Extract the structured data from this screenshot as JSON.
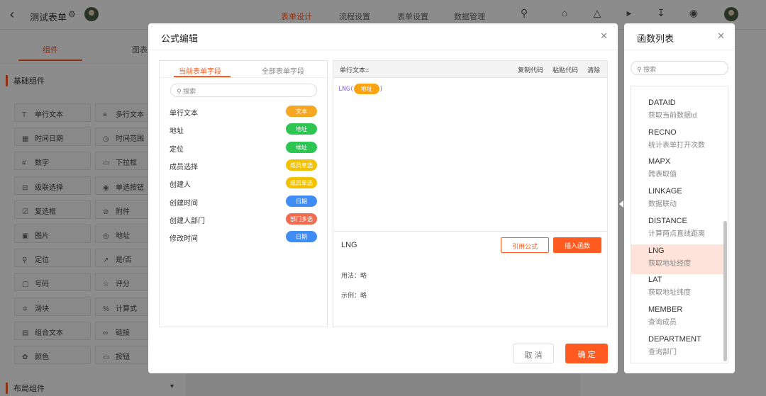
{
  "app": {
    "title": "测试表单"
  },
  "top_tabs": [
    "表单设计",
    "流程设置",
    "表单设置",
    "数据管理"
  ],
  "left_panel": {
    "tabs": [
      "组件",
      "图表"
    ],
    "section": "基础组件",
    "components": [
      "单行文本",
      "多行文本",
      "时间日期",
      "时间范围",
      "数字",
      "下拉框",
      "级联选择",
      "单选按钮",
      "复选框",
      "附件",
      "图片",
      "地址",
      "定位",
      "是/否",
      "号码",
      "评分",
      "滑块",
      "计算式",
      "组合文本",
      "链接",
      "颜色",
      "按钮"
    ],
    "bottom_section": "布局组件"
  },
  "modal": {
    "title": "公式编辑",
    "field_tabs": [
      "当前表单字段",
      "全部表单字段"
    ],
    "search_placeholder": "搜索",
    "fields": [
      {
        "label": "单行文本",
        "type": "文本",
        "color": "#f5a623"
      },
      {
        "label": "地址",
        "type": "地址",
        "color": "#2dc653"
      },
      {
        "label": "定位",
        "type": "地址",
        "color": "#2dc653"
      },
      {
        "label": "成员选择",
        "type": "成员单选",
        "color": "#f2c200"
      },
      {
        "label": "创建人",
        "type": "成员单选",
        "color": "#f2c200"
      },
      {
        "label": "创建时间",
        "type": "日期",
        "color": "#3f8cf4"
      },
      {
        "label": "创建人部门",
        "type": "部门多选",
        "color": "#f26b4f"
      },
      {
        "label": "修改时间",
        "type": "日期",
        "color": "#3f8cf4"
      }
    ],
    "editor": {
      "target": "单行文本=",
      "actions": [
        "复制代码",
        "粘贴代码",
        "清除"
      ],
      "formula_fn": "LNG(",
      "formula_arg": "地址",
      "formula_close": ")"
    },
    "function_detail": {
      "name": "LNG",
      "cite_button": "引用公式",
      "insert_button": "插入函数",
      "usage": "用法：略",
      "example": "示例：略"
    },
    "cancel": "取 消",
    "ok": "确 定"
  },
  "function_panel": {
    "title": "函数列表",
    "search_placeholder": "搜索",
    "functions": [
      {
        "name": "DATAID",
        "desc": "获取当前数据Id"
      },
      {
        "name": "RECNO",
        "desc": "统计表单打开次数"
      },
      {
        "name": "MAPX",
        "desc": "跨表取值"
      },
      {
        "name": "LINKAGE",
        "desc": "数据联动"
      },
      {
        "name": "DISTANCE",
        "desc": "计算两点直线距离"
      },
      {
        "name": "LNG",
        "desc": "获取地址经度"
      },
      {
        "name": "LAT",
        "desc": "获取地址纬度"
      },
      {
        "name": "MEMBER",
        "desc": "查询成员"
      },
      {
        "name": "DEPARTMENT",
        "desc": "查询部门"
      }
    ],
    "selected": "LNG"
  }
}
